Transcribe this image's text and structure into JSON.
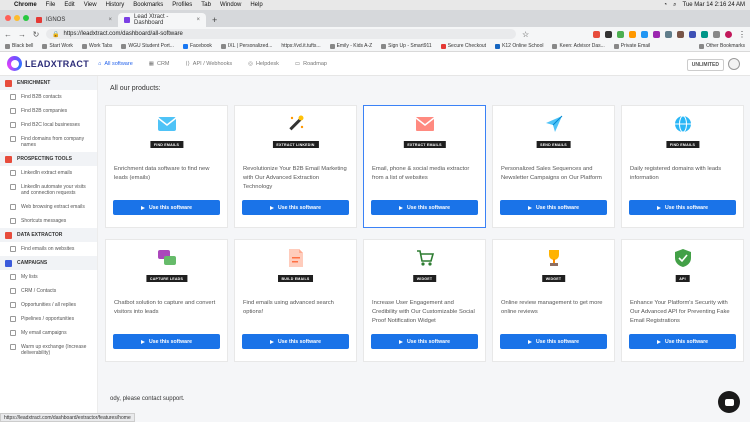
{
  "macbar": {
    "items": [
      "Chrome",
      "File",
      "Edit",
      "View",
      "History",
      "Bookmarks",
      "Profiles",
      "Tab",
      "Window",
      "Help"
    ],
    "clock": "Tue Mar 14  2:16 24 AM"
  },
  "tabs": [
    {
      "label": "IGNOS",
      "active": false
    },
    {
      "label": "Lead Xtract - Dashboard",
      "active": true
    }
  ],
  "address": {
    "url": "https://leadxtract.com/dashboard/all-software"
  },
  "bookmarks": {
    "items": [
      "Black bell",
      "Start Work",
      "Work Tabs",
      "WGU Student Port...",
      "Facebook",
      "IXL | Personalized...",
      "https://vd.it.tufts...",
      "Emily - Kids A-Z",
      "Sign Up - Smart911",
      "Secure Checkout",
      "K12 Online School",
      "Keen: Advisor Das...",
      "Private Email"
    ],
    "other": "Other Bookmarks"
  },
  "header": {
    "logo_text": "LEADXTRACT",
    "nav": [
      "All software",
      "CRM",
      "API / Webhooks",
      "Helpdesk",
      "Roadmap"
    ],
    "plan": "UNLIMITED"
  },
  "sidebar": {
    "sections": [
      {
        "title": "ENRICHMENT",
        "color": "#e74c3c",
        "items": [
          "Find B2B contacts",
          "Find B2B companies",
          "Find B2C local businesses",
          "Find domains from company names"
        ]
      },
      {
        "title": "PROSPECTING TOOLS",
        "color": "#e74c3c",
        "items": [
          "LinkedIn extract emails",
          "LinkedIn automate your visits and connection requests",
          "Web browsing extract emails",
          "Shortcuts messages"
        ]
      },
      {
        "title": "DATA EXTRACTOR",
        "color": "#e74c3c",
        "items": [
          "Find emails on websites"
        ]
      },
      {
        "title": "CAMPAIGNS",
        "color": "#3b5bdb",
        "items": [
          "My lists",
          "CRM / Contacts",
          "Opportunities / all replies",
          "Pipelines / opportunities",
          "My email campaigns",
          "Warm up exchange (Increase deliverability)"
        ]
      }
    ]
  },
  "main": {
    "title": "All our products:",
    "button_label": "Use this software",
    "footer_text": "ody, please contact support.",
    "cards": [
      {
        "badge": "FIND EMAILS",
        "icon": "envelope-icon",
        "desc": "Enrichment data software to find new leads (emails)"
      },
      {
        "badge": "EXTRACT LINKEDIN",
        "icon": "magic-wand-icon",
        "desc": "Revolutionize Your B2B Email Marketing with Our Advanced Extraction Technology"
      },
      {
        "badge": "EXTRACT EMAILS",
        "icon": "mail-envelope-icon",
        "desc": "Email, phone & social media extractor from a list of websites"
      },
      {
        "badge": "SEND EMAILS",
        "icon": "paper-plane-icon",
        "desc": "Personalized Sales Sequences and Newsletter Campaigns on Our Platform"
      },
      {
        "badge": "FIND EMAILS",
        "icon": "globe-icon",
        "desc": "Daily registered domains with leads information"
      },
      {
        "badge": "CAPTURE LEADS",
        "icon": "chat-bubbles-icon",
        "desc": "Chatbot solution to capture and convert visitors into leads"
      },
      {
        "badge": "BUILD EMAILS",
        "icon": "document-icon",
        "desc": "Find emails using advanced search options!"
      },
      {
        "badge": "WIDGET",
        "icon": "shopping-cart-icon",
        "desc": "Increase User Engagement and Credibility with Our Customizable Social Proof Notification Widget"
      },
      {
        "badge": "WIDGET",
        "icon": "trophy-icon",
        "desc": "Online review management to get more online reviews"
      },
      {
        "badge": "API",
        "icon": "shield-icon",
        "desc": "Enhance Your Platform's Security with Our Advanced API for Preventing Fake Email Registrations"
      }
    ]
  },
  "status_bar": "https://leadxtract.com/dashboard/extractor/features/home"
}
